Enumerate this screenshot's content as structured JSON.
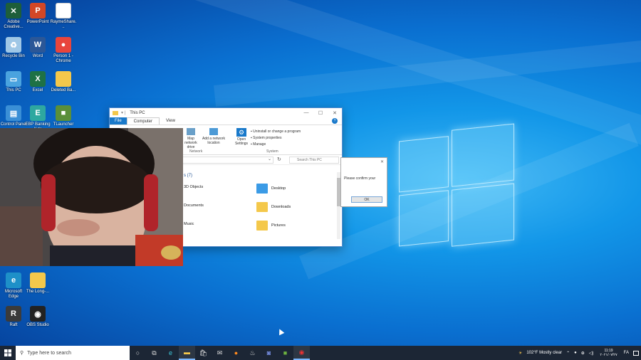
{
  "desktop_icons": [
    {
      "label": "Adobe Creative...",
      "icon": "adobe-cc-icon",
      "color": "#1e5e3a",
      "glyph": "✕"
    },
    {
      "label": "PowerPoint",
      "icon": "powerpoint-icon",
      "color": "#d24726",
      "glyph": "P"
    },
    {
      "label": "RaymeShare...",
      "icon": "document-icon",
      "color": "#ffffff",
      "glyph": ""
    },
    {
      "label": "Recycle Bin",
      "icon": "recycle-bin-icon",
      "color": "#9fc7e6",
      "glyph": "♻"
    },
    {
      "label": "Word",
      "icon": "word-icon",
      "color": "#2b5797",
      "glyph": "W"
    },
    {
      "label": "Person 1 - Chrome",
      "icon": "chrome-icon",
      "color": "#e8453c",
      "glyph": "●"
    },
    {
      "label": "This PC",
      "icon": "this-pc-icon",
      "color": "#4aa3df",
      "glyph": "▭"
    },
    {
      "label": "Excel",
      "icon": "excel-icon",
      "color": "#1e7145",
      "glyph": "X"
    },
    {
      "label": "Deleted Ba...",
      "icon": "folder-icon",
      "color": "#f4c84b",
      "glyph": ""
    },
    {
      "label": "Control Panel",
      "icon": "control-panel-icon",
      "color": "#3a8fd6",
      "glyph": "▤"
    },
    {
      "label": "EBP Banking Aide",
      "icon": "ebp-icon",
      "color": "#2ea8a0",
      "glyph": "E"
    },
    {
      "label": "TLauncher",
      "icon": "minecraft-icon",
      "color": "#5a8f3a",
      "glyph": "■"
    },
    {
      "label": "Microsoft Edge",
      "icon": "edge-icon",
      "color": "#1e90c8",
      "glyph": "e"
    },
    {
      "label": "The Long-...",
      "icon": "folder-icon",
      "color": "#f4c84b",
      "glyph": ""
    },
    {
      "label": "Raft",
      "icon": "raft-icon",
      "color": "#3b3b3b",
      "glyph": "R"
    },
    {
      "label": "OBS Studio",
      "icon": "obs-icon",
      "color": "#222222",
      "glyph": "◉"
    }
  ],
  "explorer": {
    "title": "This PC",
    "tabs": [
      "File",
      "Computer",
      "View"
    ],
    "ribbon": {
      "network_items": [
        "Map network drive",
        "Add a network location"
      ],
      "open_settings": "Open Settings",
      "system_items": [
        "Uninstall or change a program",
        "System properties",
        "Manage"
      ],
      "group_network": "Network",
      "group_system": "System"
    },
    "search_placeholder": "Search This PC",
    "section_header": "s (7)",
    "folders": [
      "3D Objects",
      "Desktop",
      "Documents",
      "Downloads",
      "Music",
      "Pictures"
    ]
  },
  "dialog": {
    "message": "Please confirm your",
    "ok_label": "OK"
  },
  "taskbar": {
    "search_placeholder": "Type here to search",
    "weather": "102°F  Mostly clear",
    "time": "11:19",
    "date": "۲۰۲۱/۰۷/۲۷",
    "lang": "FA",
    "ampm": "بعدازظهر"
  },
  "colors": {
    "accent": "#1979ca",
    "taskbar_bg": "#1c2635"
  }
}
